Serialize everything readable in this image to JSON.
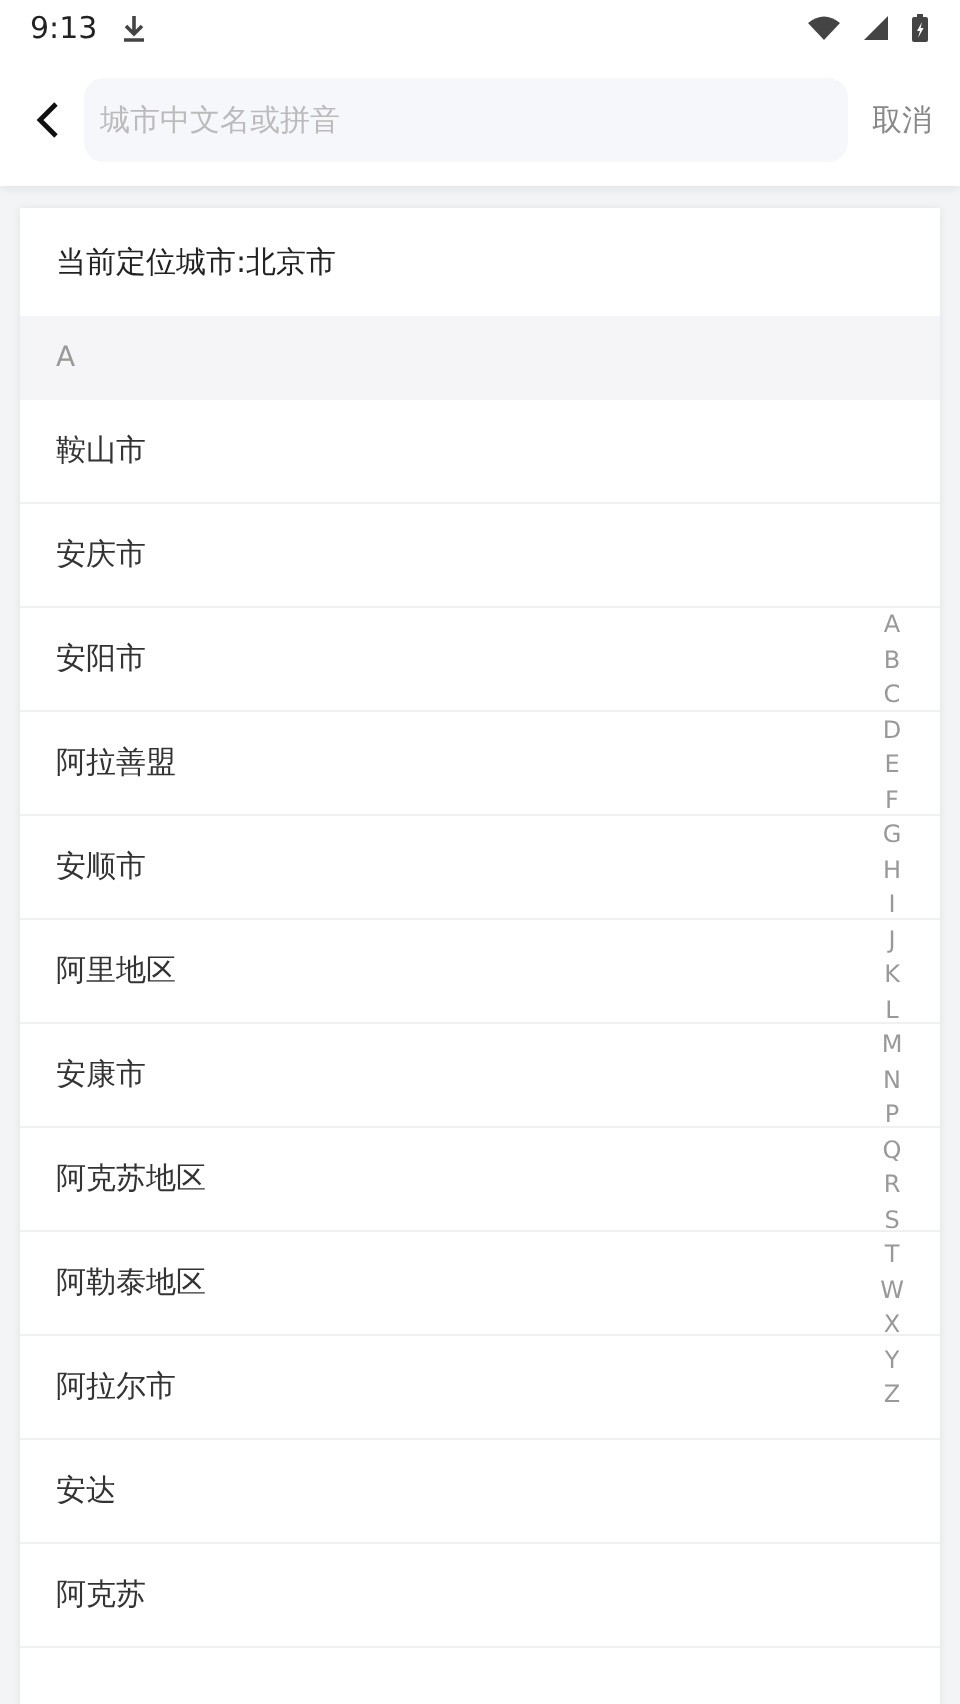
{
  "status_bar": {
    "time": "9:13"
  },
  "search": {
    "placeholder": "城市中文名或拼音",
    "cancel": "取消"
  },
  "current_location": "当前定位城市:北京市",
  "section": "A",
  "cities": [
    "鞍山市",
    "安庆市",
    "安阳市",
    "阿拉善盟",
    "安顺市",
    "阿里地区",
    "安康市",
    "阿克苏地区",
    "阿勒泰地区",
    "阿拉尔市",
    "安达",
    "阿克苏"
  ],
  "index": [
    "A",
    "B",
    "C",
    "D",
    "E",
    "F",
    "G",
    "H",
    "I",
    "J",
    "K",
    "L",
    "M",
    "N",
    "P",
    "Q",
    "R",
    "S",
    "T",
    "W",
    "X",
    "Y",
    "Z"
  ]
}
